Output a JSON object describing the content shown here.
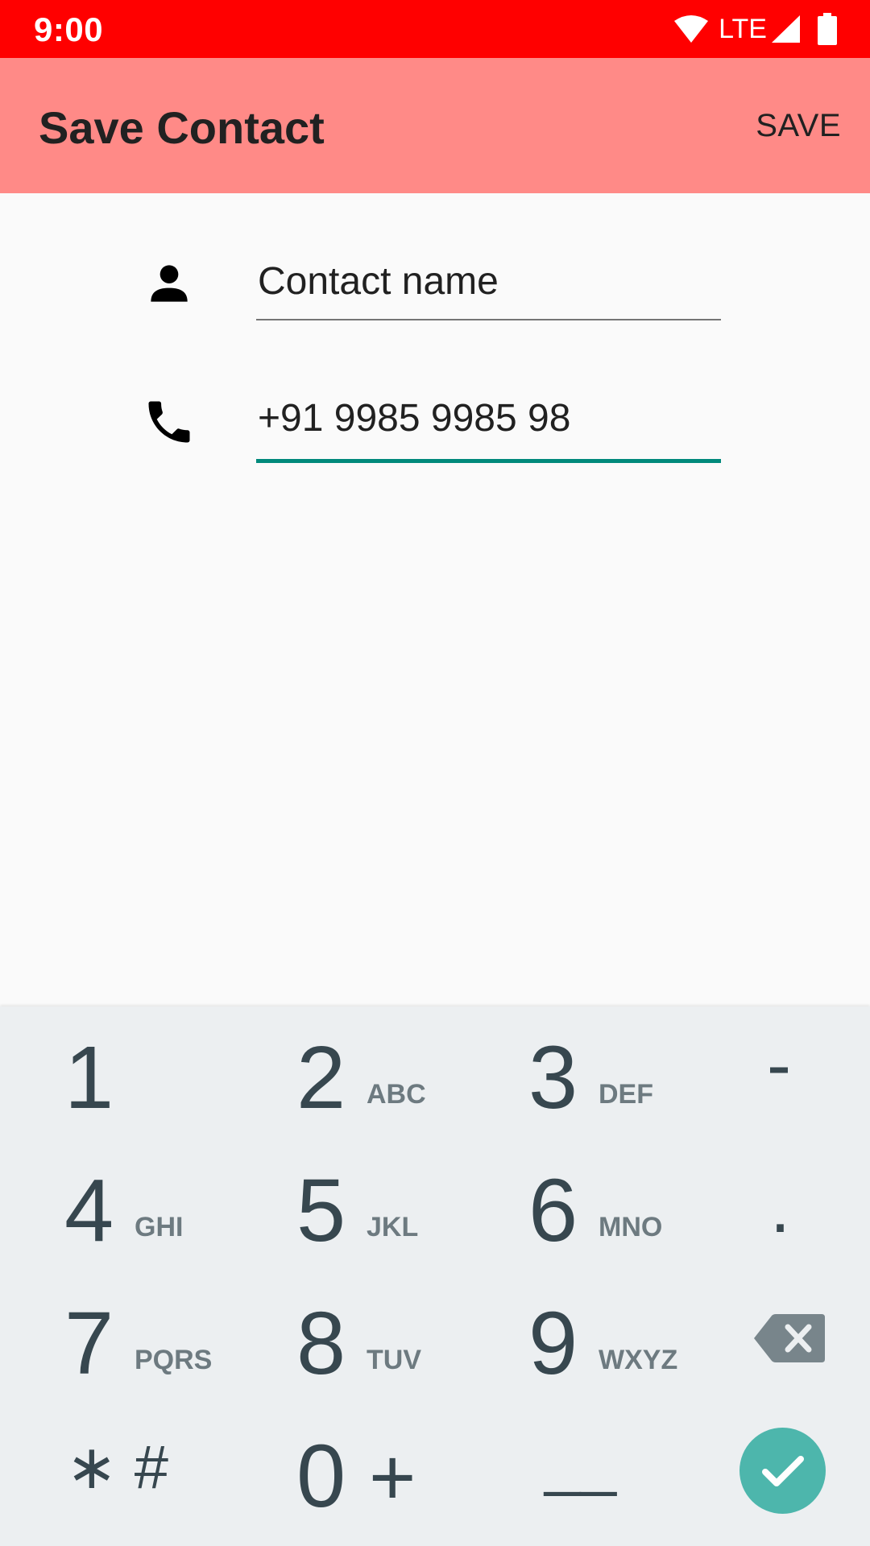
{
  "status_bar": {
    "time": "9:00",
    "network": "LTE"
  },
  "app_bar": {
    "title": "Save Contact",
    "save_label": "SAVE"
  },
  "form": {
    "name_placeholder": "Contact name",
    "phone_value": "+91 9985 9985 98"
  },
  "keypad": {
    "keys": [
      {
        "digit": "1",
        "letters": ""
      },
      {
        "digit": "2",
        "letters": "ABC"
      },
      {
        "digit": "3",
        "letters": "DEF"
      },
      {
        "digit": "4",
        "letters": "GHI"
      },
      {
        "digit": "5",
        "letters": "JKL"
      },
      {
        "digit": "6",
        "letters": "MNO"
      },
      {
        "digit": "7",
        "letters": "PQRS"
      },
      {
        "digit": "8",
        "letters": "TUV"
      },
      {
        "digit": "9",
        "letters": "WXYZ"
      },
      {
        "digit": "0",
        "letters": "+"
      }
    ],
    "star_hash": "∗ #",
    "dash": "-",
    "dot": ".",
    "underscore": "__"
  },
  "colors": {
    "status_bar": "#ff0000",
    "app_bar": "#ff8a87",
    "accent": "#00897b",
    "keypad_bg": "#eceff1",
    "done": "#4db6ac"
  },
  "icons": [
    "wifi-icon",
    "signal-icon",
    "battery-icon",
    "person-icon",
    "phone-icon",
    "backspace-icon",
    "check-icon"
  ]
}
